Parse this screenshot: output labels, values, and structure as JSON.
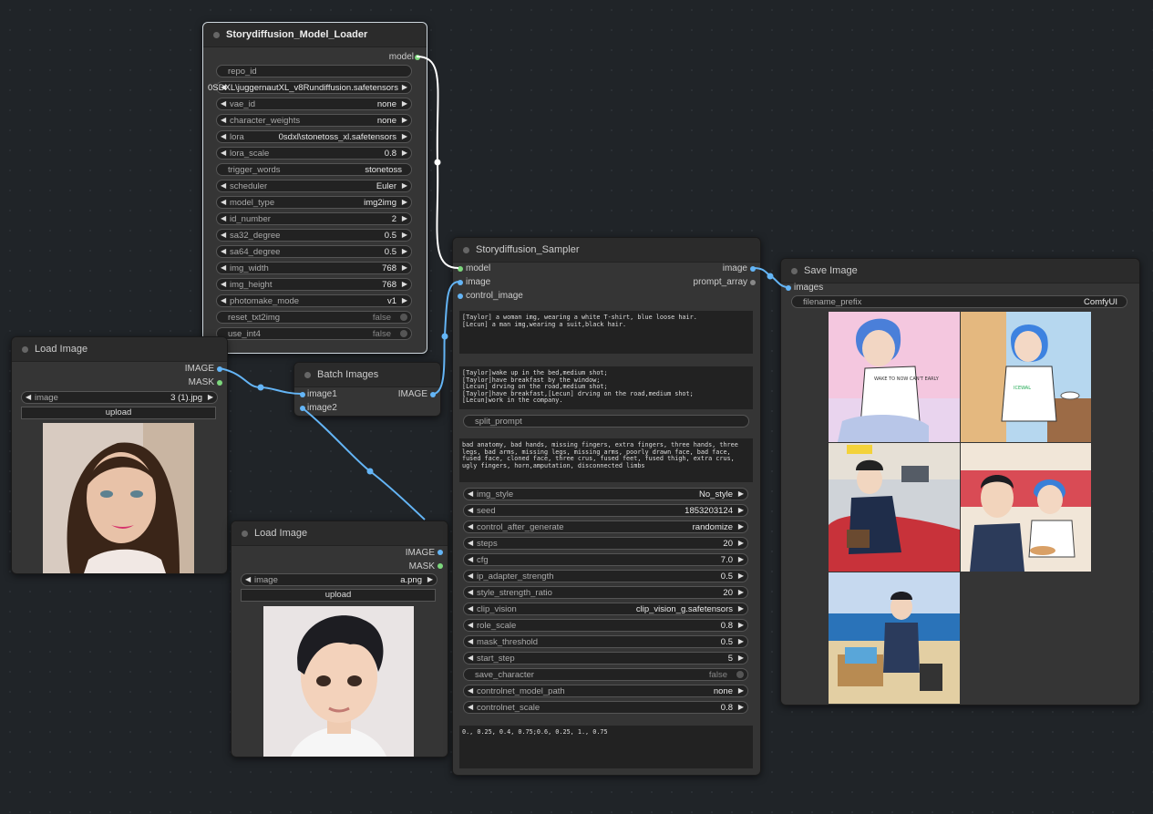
{
  "model_loader": {
    "title": "Storydiffusion_Model_Loader",
    "output_model": "model",
    "widgets": [
      {
        "name": "repo_id",
        "value": "",
        "kind": "text"
      },
      {
        "name": "0SDXL\\juggernautXL_v8Rundiffusion.safetensors",
        "value": "0SDXL\\juggernautXL_v8Rundiffusion.safetensors",
        "kind": "combo",
        "overlap": true
      },
      {
        "name": "vae_id",
        "value": "none",
        "kind": "combo"
      },
      {
        "name": "character_weights",
        "value": "none",
        "kind": "combo"
      },
      {
        "name": "lora",
        "value": "0sdxl\\stonetoss_xl.safetensors",
        "kind": "combo"
      },
      {
        "name": "lora_scale",
        "value": "0.8",
        "kind": "combo"
      },
      {
        "name": "trigger_words",
        "value": "stonetoss",
        "kind": "text"
      },
      {
        "name": "scheduler",
        "value": "Euler",
        "kind": "combo"
      },
      {
        "name": "model_type",
        "value": "img2img",
        "kind": "combo"
      },
      {
        "name": "id_number",
        "value": "2",
        "kind": "combo"
      },
      {
        "name": "sa32_degree",
        "value": "0.5",
        "kind": "combo"
      },
      {
        "name": "sa64_degree",
        "value": "0.5",
        "kind": "combo"
      },
      {
        "name": "img_width",
        "value": "768",
        "kind": "combo"
      },
      {
        "name": "img_height",
        "value": "768",
        "kind": "combo"
      },
      {
        "name": "photomake_mode",
        "value": "v1",
        "kind": "combo"
      },
      {
        "name": "reset_txt2img",
        "value": "false",
        "kind": "toggle"
      },
      {
        "name": "use_int4",
        "value": "false",
        "kind": "toggle"
      }
    ]
  },
  "load_image_1": {
    "title": "Load Image",
    "out_image": "IMAGE",
    "out_mask": "MASK",
    "image_label": "image",
    "image_value": "3 (1).jpg",
    "upload": "upload"
  },
  "batch_images": {
    "title": "Batch Images",
    "in1": "image1",
    "in2": "image2",
    "out": "IMAGE"
  },
  "load_image_2": {
    "title": "Load Image",
    "out_image": "IMAGE",
    "out_mask": "MASK",
    "image_label": "image",
    "image_value": "a.png",
    "upload": "upload"
  },
  "sampler": {
    "title": "Storydiffusion_Sampler",
    "in_model": "model",
    "in_image": "image",
    "in_control_image": "control_image",
    "out_image": "image",
    "out_prompt_array": "prompt_array",
    "character_prompt": "[Taylor] a woman img, wearing a white T-shirt, blue loose hair.\n[Lecun] a man img,wearing a suit,black hair.",
    "scene_prompts": "[Taylor]wake up in the bed,medium shot;\n[Taylor]have breakfast by the window;\n[Lecun] drving on the road,medium shot;\n[Taylor]have breakfast,[Lecun] drving on the road,medium shot;\n[Lecun]work in the company.",
    "split_prompt": "split_prompt",
    "negative_prompt": "bad anatomy, bad hands, missing fingers, extra fingers, three hands, three legs, bad arms, missing legs, missing arms, poorly drawn face, bad face, fused face, cloned face, three crus, fused feet, fused thigh, extra crus, ugly fingers, horn,amputation, disconnected limbs",
    "widgets": [
      {
        "name": "img_style",
        "value": "No_style",
        "kind": "combo"
      },
      {
        "name": "seed",
        "value": "1853203124",
        "kind": "combo"
      },
      {
        "name": "control_after_generate",
        "value": "randomize",
        "kind": "combo"
      },
      {
        "name": "steps",
        "value": "20",
        "kind": "combo"
      },
      {
        "name": "cfg",
        "value": "7.0",
        "kind": "combo"
      },
      {
        "name": "ip_adapter_strength",
        "value": "0.5",
        "kind": "combo"
      },
      {
        "name": "style_strength_ratio",
        "value": "20",
        "kind": "combo"
      },
      {
        "name": "clip_vision",
        "value": "clip_vision_g.safetensors",
        "kind": "combo"
      },
      {
        "name": "role_scale",
        "value": "0.8",
        "kind": "combo"
      },
      {
        "name": "mask_threshold",
        "value": "0.5",
        "kind": "combo"
      },
      {
        "name": "start_step",
        "value": "5",
        "kind": "combo"
      },
      {
        "name": "save_character",
        "value": "false",
        "kind": "toggle"
      },
      {
        "name": "controlnet_model_path",
        "value": "none",
        "kind": "combo"
      },
      {
        "name": "controlnet_scale",
        "value": "0.8",
        "kind": "combo"
      }
    ],
    "bottom_text": "0., 0.25, 0.4, 0.75;0.6, 0.25, 1., 0.75"
  },
  "save_image": {
    "title": "Save Image",
    "in_images": "images",
    "filename_prefix_label": "filename_prefix",
    "filename_prefix_value": "ComfyUI",
    "sign_text": "WAKE TO NOW CAN'T EARLY",
    "tshirt_text": "ICEWAL"
  },
  "colors": {
    "link_model": "#ffffff",
    "link_image": "#64b5f6",
    "socket_model": "#7dd87d",
    "socket_image": "#64b5f6"
  }
}
